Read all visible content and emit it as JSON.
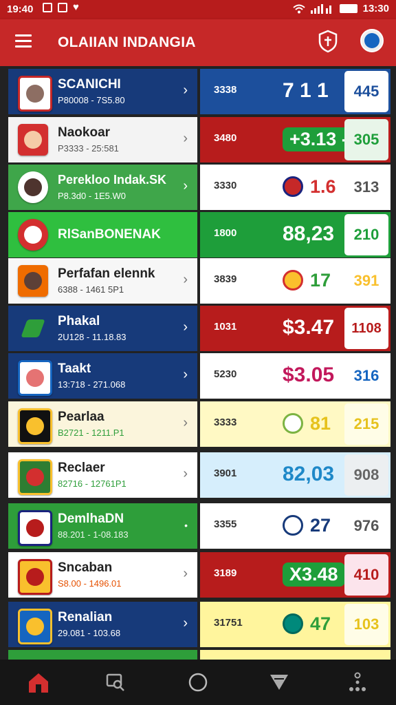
{
  "status": {
    "time": "19:40",
    "time_right": "13:30"
  },
  "app": {
    "title": "OLAIIAN INDANGIA"
  },
  "rows": [
    {
      "name": "SCANICHI",
      "range": "P80008 - 7S5.80",
      "code": "3338",
      "value": "7 1 1",
      "badge": "445"
    },
    {
      "name": "Naokoar",
      "range": "P3333 - 25:581",
      "code": "3480",
      "value": "+3.13 -",
      "badge": "305"
    },
    {
      "name": "Perekloo Indak.SK",
      "range": "P8.3d0 - 1E5.W0",
      "code": "3330",
      "value": "1.6",
      "badge": "313"
    },
    {
      "name": "RlSanBONENAK",
      "range": "",
      "code": "1800",
      "value": "88,23",
      "badge": "210"
    },
    {
      "name": "Perfafan elennk",
      "range": "6388 - 1461 5P1",
      "code": "3839",
      "value": "17",
      "badge": "391"
    },
    {
      "name": "Phakal",
      "range": "2U128 - 11.18.83",
      "code": "1031",
      "value": "$3.47",
      "badge": "1108"
    },
    {
      "name": "Taakt",
      "range": "13:718 - 271.068",
      "code": "5230",
      "value": "$3.05",
      "badge": "316"
    },
    {
      "name": "Pearlaa",
      "range": "B2721 - 1211.P1",
      "code": "3333",
      "value": "81",
      "badge": "215"
    },
    {
      "name": "Reclaer",
      "range": "82716 - 12761P1",
      "code": "3901",
      "value": "82,03",
      "badge": "908"
    },
    {
      "name": "DemlhaDN",
      "range": "88.201 - 1-08.183",
      "code": "3355",
      "value": "27",
      "badge": "976"
    },
    {
      "name": "Sncaban",
      "range": "S8.00 - 1496.01",
      "code": "3189",
      "value": "X3.48",
      "badge": "410"
    },
    {
      "name": "Renalian",
      "range": "29.081 - 103.68",
      "code": "31751",
      "value": "47",
      "badge": "103"
    }
  ]
}
